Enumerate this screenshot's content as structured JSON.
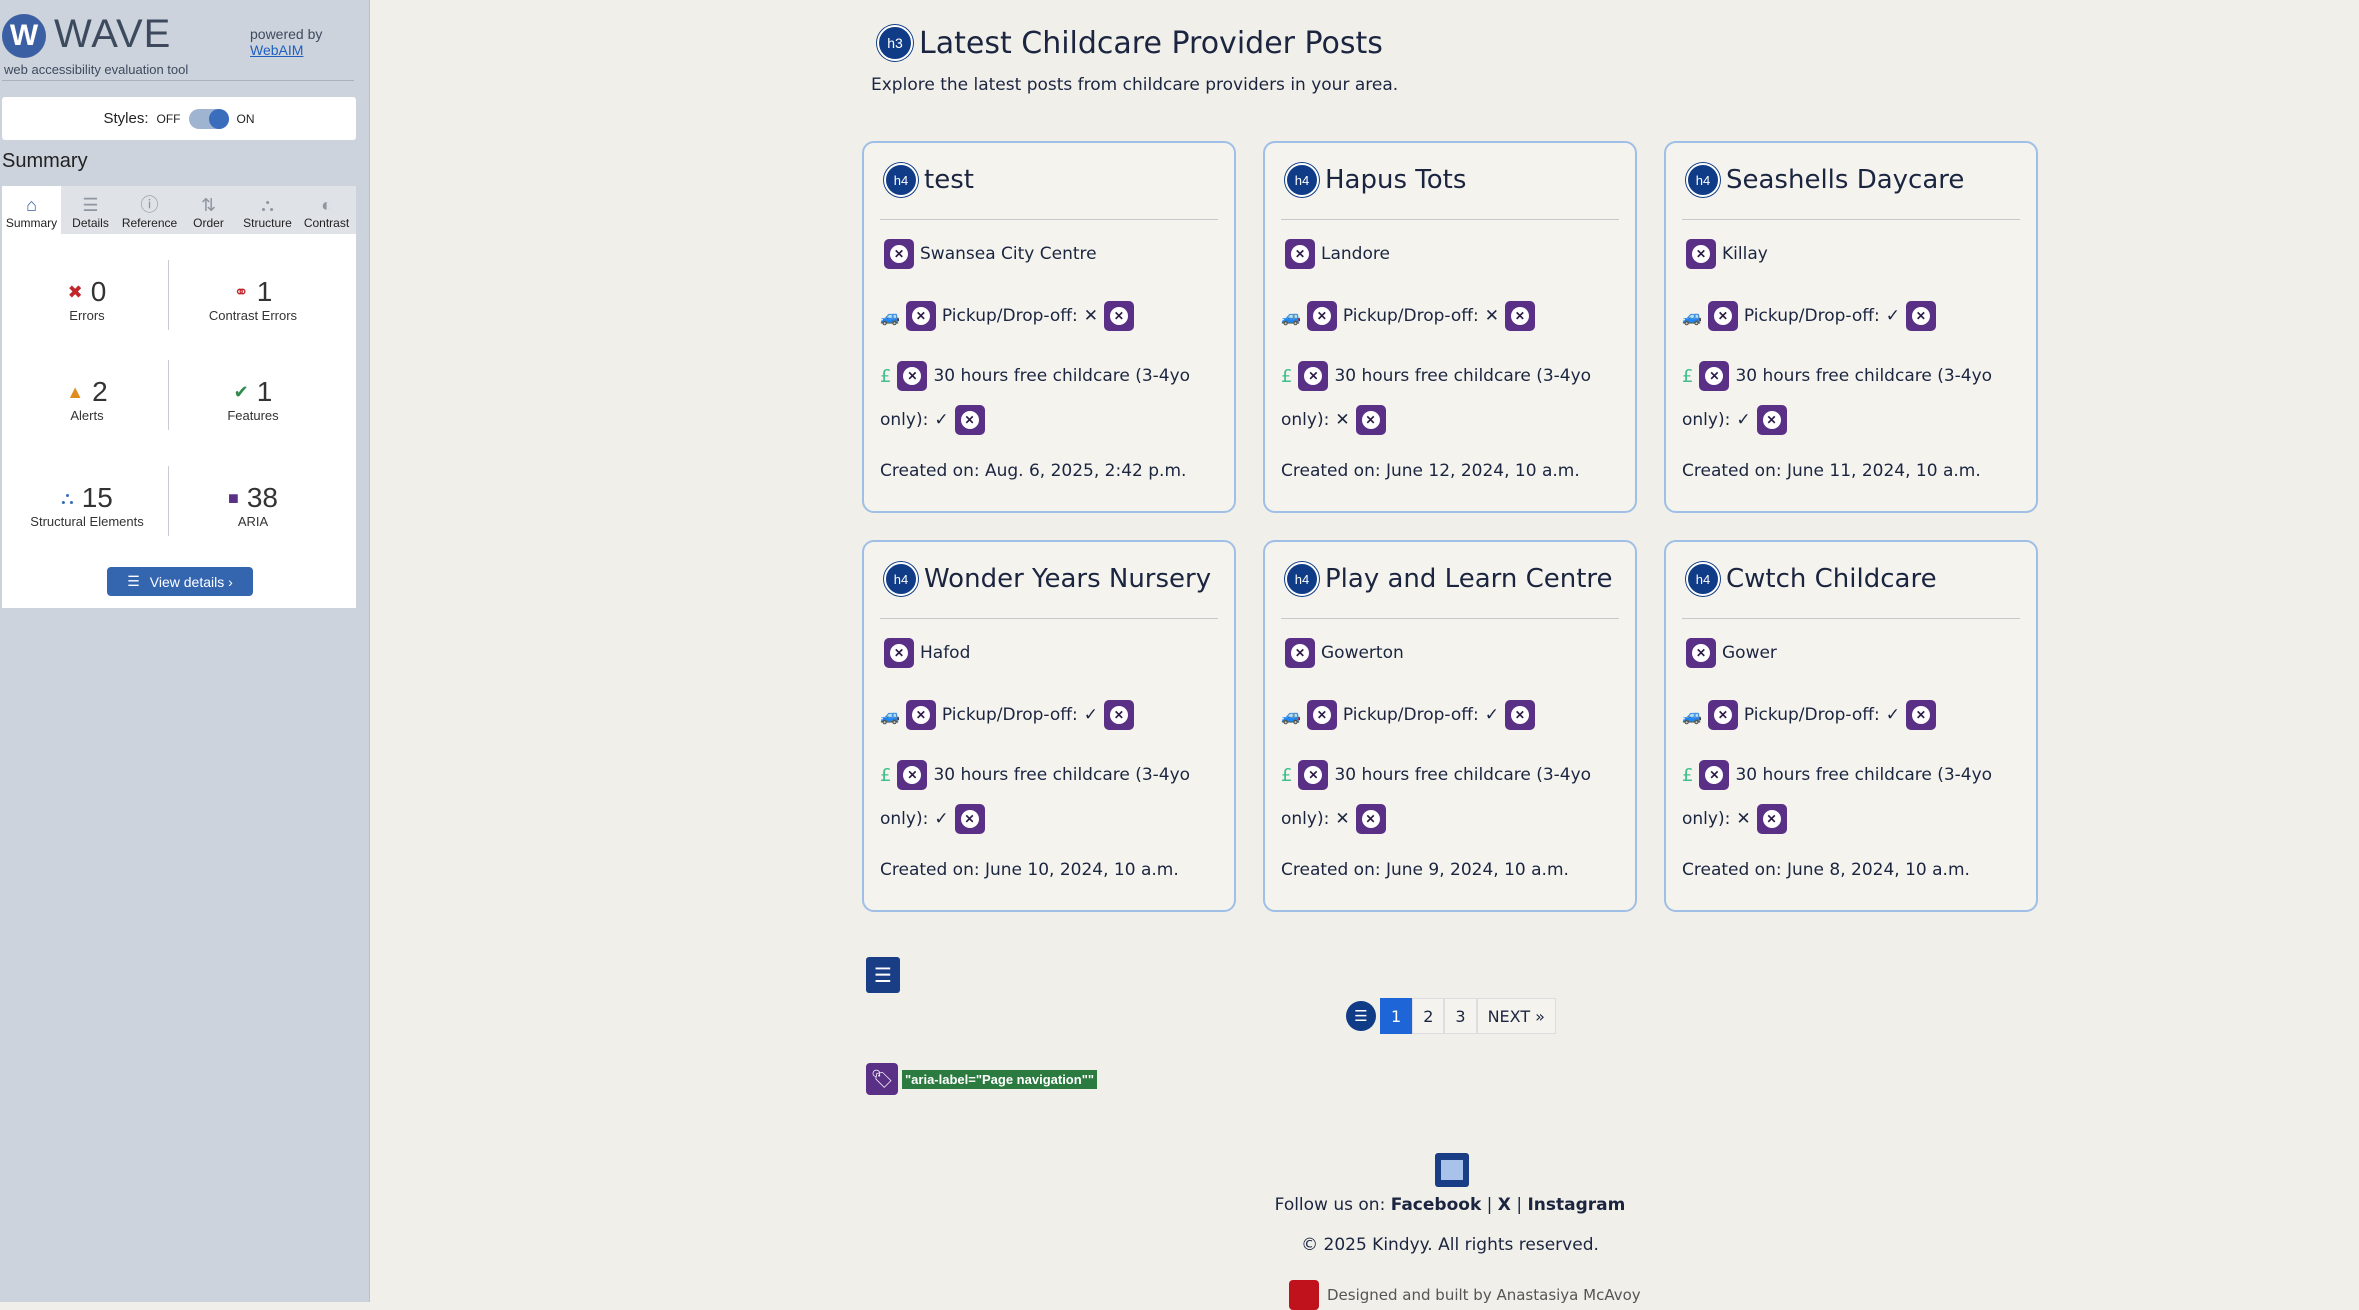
{
  "wave": {
    "logo_letter": "W",
    "logo_text": "WAVE",
    "tagline": "web accessibility evaluation tool",
    "powered_by": "powered by",
    "webaim": "WebAIM",
    "styles_label": "Styles:",
    "styles_off": "OFF",
    "styles_on": "ON",
    "summary_heading": "Summary",
    "tabs": [
      {
        "label": "Summary",
        "icon": "home-icon",
        "glyph": "⌂"
      },
      {
        "label": "Details",
        "icon": "list-icon",
        "glyph": "☰"
      },
      {
        "label": "Reference",
        "icon": "info-icon",
        "glyph": "ⓘ"
      },
      {
        "label": "Order",
        "icon": "order-icon",
        "glyph": "⇅"
      },
      {
        "label": "Structure",
        "icon": "structure-icon",
        "glyph": "⛬"
      },
      {
        "label": "Contrast",
        "icon": "contrast-icon",
        "glyph": "◐"
      }
    ],
    "stats": {
      "errors": {
        "value": "0",
        "label": "Errors"
      },
      "contrast_errors": {
        "value": "1",
        "label": "Contrast Errors"
      },
      "alerts": {
        "value": "2",
        "label": "Alerts"
      },
      "features": {
        "value": "1",
        "label": "Features"
      },
      "structural": {
        "value": "15",
        "label": "Structural Elements"
      },
      "aria": {
        "value": "38",
        "label": "ARIA"
      }
    },
    "view_details": "View details ›"
  },
  "page": {
    "title_badge": "h3",
    "title": "Latest Childcare Provider Posts",
    "subtitle": "Explore the latest posts from childcare providers in your area.",
    "card_badge": "h4",
    "pickup_label": "Pickup/Drop-off:",
    "hours_label": "30 hours free childcare (3-4yo",
    "only_label": "only):",
    "cards": [
      {
        "title": "test",
        "location": "Swansea City Centre",
        "pickup": "✕",
        "hours": "✓",
        "created": "Created on: Aug. 6, 2025, 2:42 p.m."
      },
      {
        "title": "Hapus Tots",
        "location": "Landore",
        "pickup": "✕",
        "hours": "✕",
        "created": "Created on: June 12, 2024, 10 a.m."
      },
      {
        "title": "Seashells Daycare",
        "location": "Killay",
        "pickup": "✓",
        "hours": "✓",
        "created": "Created on: June 11, 2024, 10 a.m."
      },
      {
        "title": "Wonder Years Nursery",
        "location": "Hafod",
        "pickup": "✓",
        "hours": "✓",
        "created": "Created on: June 10, 2024, 10 a.m."
      },
      {
        "title": "Play and Learn Centre",
        "location": "Gowerton",
        "pickup": "✓",
        "hours": "✕",
        "created": "Created on: June 9, 2024, 10 a.m."
      },
      {
        "title": "Cwtch Childcare",
        "location": "Gower",
        "pickup": "✓",
        "hours": "✕",
        "created": "Created on: June 8, 2024, 10 a.m."
      }
    ],
    "pagination": {
      "pages": [
        "1",
        "2",
        "3"
      ],
      "active": "1",
      "next": "NEXT »"
    },
    "aria_label_tag": "\"aria-label=\"Page navigation\"\"",
    "footer": {
      "follow_prefix": "Follow us on:",
      "facebook": "Facebook",
      "sep": "|",
      "x": "X",
      "instagram": "Instagram",
      "copyright": "© 2025 Kindyy. All rights reserved.",
      "designed": "Designed and built by Anastasiya McAvoy"
    }
  },
  "colors": {
    "wave_sidebar": "#ccd3dc",
    "page_bg": "#f0efe9",
    "card_border": "#9fbfe6",
    "heading_badge": "#103b86",
    "aria_icon": "#5a2f86",
    "pagination_active": "#1e66d8"
  }
}
